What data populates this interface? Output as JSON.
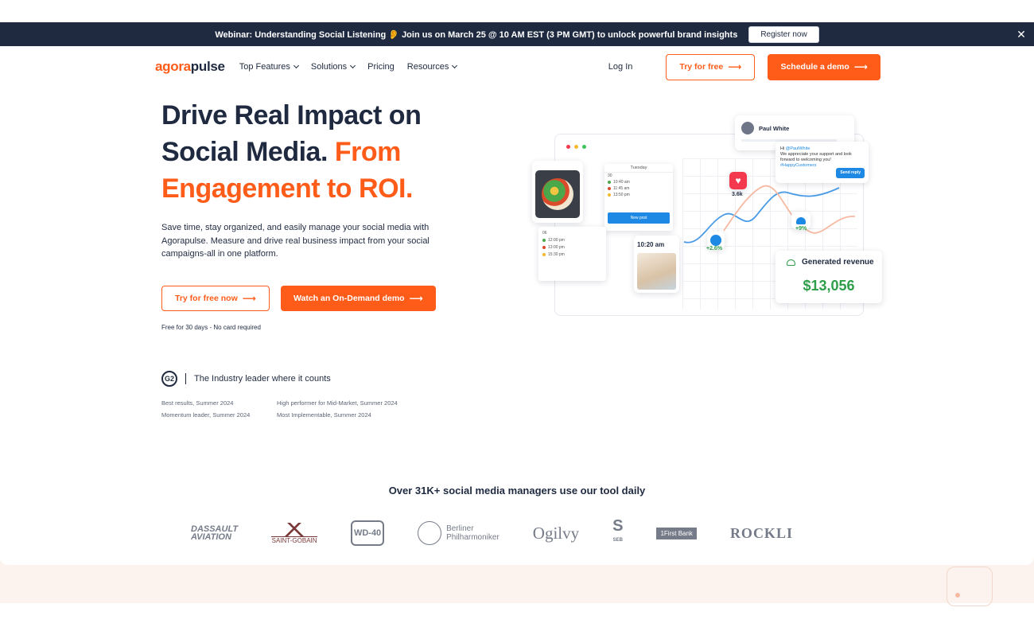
{
  "banner": {
    "text": "Webinar: Understanding Social Listening 👂 Join us on March 25 @ 10 AM EST (3 PM GMT) to unlock powerful brand insights",
    "button": "Register now",
    "close": "✕"
  },
  "nav": {
    "logo_a": "agora",
    "logo_b": "pulse",
    "items": [
      {
        "label": "Top Features"
      },
      {
        "label": "Solutions"
      },
      {
        "label": "Pricing"
      },
      {
        "label": "Resources"
      }
    ],
    "login": "Log In",
    "try_free": "Try for free",
    "schedule_demo": "Schedule a demo"
  },
  "hero": {
    "title_line1": "Drive Real Impact on",
    "title_line2a": "Social Media.",
    "title_line2b": "From",
    "title_line3": "Engagement to ROI.",
    "subtitle": "Save time, stay organized, and easily manage your social media with Agorapulse. Measure and drive real business impact from your social campaigns-all in one platform.",
    "btn_try": "Try for free now",
    "btn_demo": "Watch an On-Demand demo",
    "note": "Free for 30 days - No card required"
  },
  "g2": {
    "badge": "G2",
    "tagline": "The Industry leader where it counts",
    "awards": [
      "Best results, Summer 2024",
      "High performer for Mid-Market, Summer 2024",
      "Momentum leader, Summer 2024",
      "Most Implementable, Summer 2024"
    ]
  },
  "mockup": {
    "calendar_day": "Tuesday",
    "calendar_date": "30",
    "calendar_times": [
      "10:40 am",
      "11:45 am",
      "13:50 pm"
    ],
    "new_post": "New post",
    "calendar2_date": "06",
    "calendar2_times": [
      "12:00 pm",
      "13:00 pm",
      "15:30 pm"
    ],
    "time_label": "10:20 am",
    "profile_name": "Paul White",
    "reply_hi": "Hi",
    "reply_handle": "@PaulWhite",
    "reply_text": "We appreciate your support and look forward to welcoming you!",
    "reply_tag": "#HappyCustomers",
    "send_reply": "Send reply",
    "likes": "3.6k",
    "like_growth": "+2.6%",
    "people_growth": "+9%",
    "revenue_label": "Generated revenue",
    "revenue_value": "$13,056"
  },
  "social_proof": {
    "headline": "Over 31K+ social media managers use our tool daily",
    "logos": {
      "dassault_1": "DASSAULT",
      "dassault_2": "AVIATION",
      "saint_gobain": "SAINT-GOBAIN",
      "wd40": "WD-40",
      "berliner_1": "Berliner",
      "berliner_2": "Philharmoniker",
      "ogilvy": "Ogilvy",
      "seb": "S",
      "seb_small": "SEB",
      "first_bank": "1First Bank",
      "rockl": "ROCKLI"
    }
  },
  "colors": {
    "brand_orange": "#ff5c1a",
    "navy": "#1f2a40",
    "revenue_green": "#2e9e4a",
    "chart_blue": "#4a9be6",
    "chart_peach": "#f6b9a2"
  }
}
